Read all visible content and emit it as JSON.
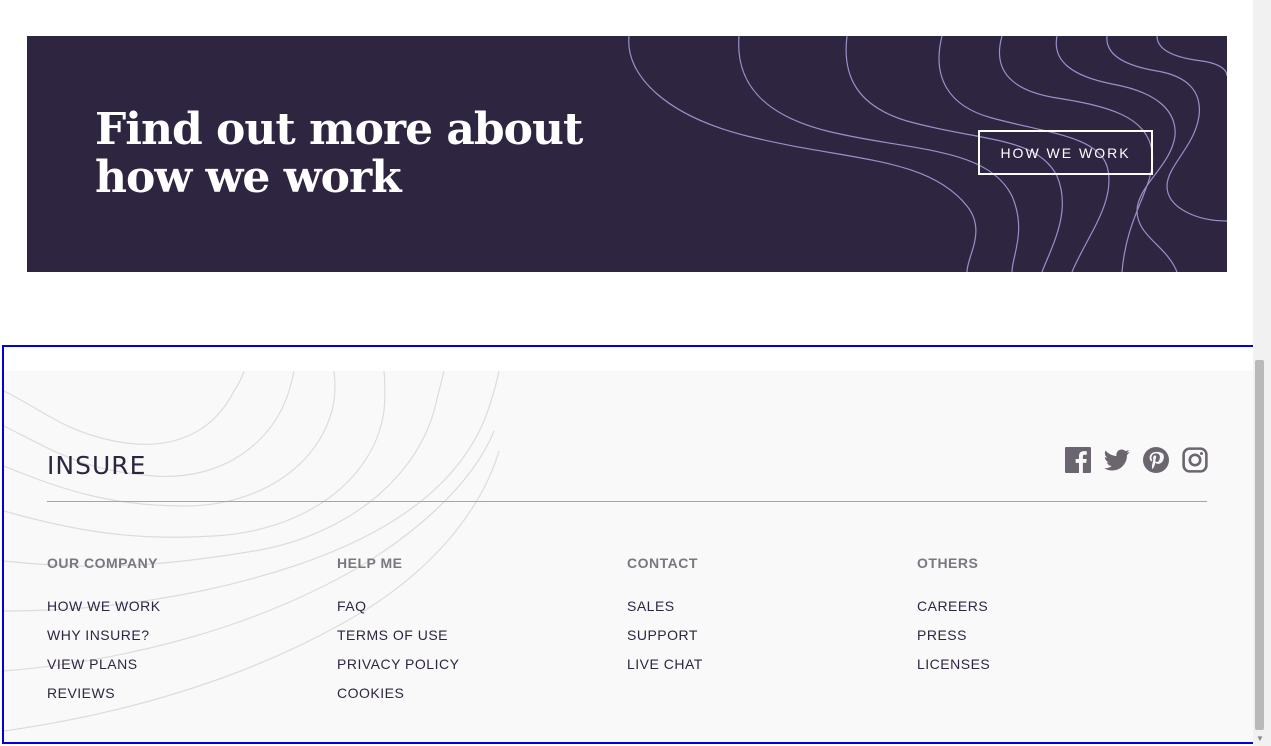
{
  "cta": {
    "title_line1": "Find out more about",
    "title_line2": "how we work",
    "button_label": "HOW WE WORK",
    "background_color": "#2e2541"
  },
  "footer": {
    "logo_text": "INSURE",
    "background_color": "#f9f9f9",
    "social_icons": [
      "facebook-icon",
      "twitter-icon",
      "pinterest-icon",
      "instagram-icon"
    ],
    "columns": [
      {
        "heading": "OUR COMPANY",
        "links": [
          "HOW WE WORK",
          "WHY INSURE?",
          "VIEW PLANS",
          "REVIEWS"
        ]
      },
      {
        "heading": "HELP ME",
        "links": [
          "FAQ",
          "TERMS OF USE",
          "PRIVACY POLICY",
          "COOKIES"
        ]
      },
      {
        "heading": "CONTACT",
        "links": [
          "SALES",
          "SUPPORT",
          "LIVE CHAT"
        ]
      },
      {
        "heading": "OTHERS",
        "links": [
          "CAREERS",
          "PRESS",
          "LICENSES"
        ]
      }
    ]
  }
}
